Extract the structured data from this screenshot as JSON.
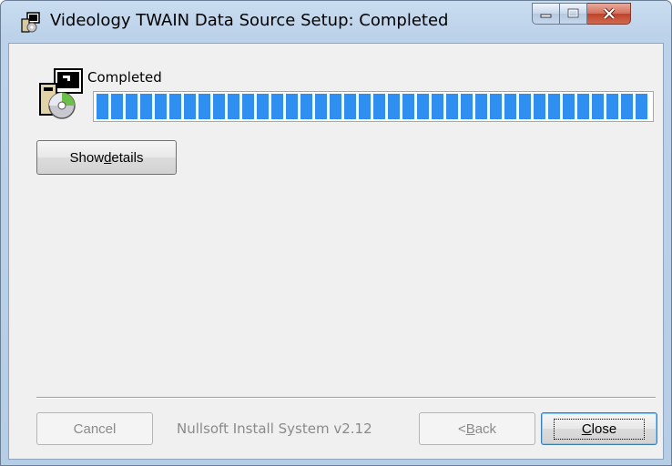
{
  "window": {
    "title": "Videology TWAIN Data Source Setup: Completed",
    "icon": "installer-icon",
    "caption_buttons": [
      "minimize-icon",
      "maximize-icon",
      "close-icon"
    ]
  },
  "main": {
    "status": "Completed",
    "progress": 1.0,
    "details_button": {
      "before": "Show ",
      "underline": "d",
      "after": "etails"
    }
  },
  "footer": {
    "cancel_label": "Cancel",
    "branding": "Nullsoft Install System v2.12",
    "back_label": {
      "before": "< ",
      "underline": "B",
      "after": "ack"
    },
    "close_label": {
      "before": "",
      "underline": "C",
      "after": "lose"
    }
  },
  "colors": {
    "progress": "#2f8ff0",
    "window_frame": "#b6cde6",
    "close_button": "#c0412a"
  }
}
